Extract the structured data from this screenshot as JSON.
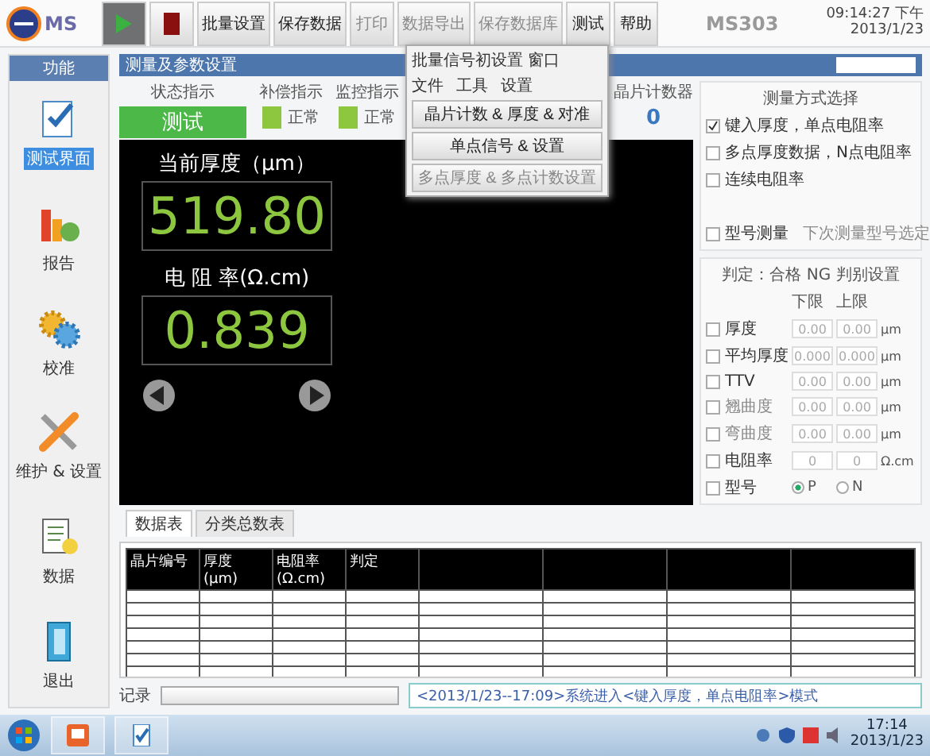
{
  "app": {
    "logo": "MS",
    "title": "MS303",
    "time": "09:14:27 下午",
    "date": "2013/1/23"
  },
  "toolbar": [
    {
      "kind": "play",
      "selected": true,
      "disabled": false
    },
    {
      "kind": "stop",
      "selected": false,
      "disabled": false
    },
    {
      "kind": "text",
      "label": "批量设置",
      "selected": false,
      "disabled": false
    },
    {
      "kind": "text",
      "label": "保存数据",
      "selected": false,
      "disabled": false
    },
    {
      "kind": "text",
      "label": "打印",
      "selected": false,
      "disabled": true
    },
    {
      "kind": "text",
      "label": "数据导出",
      "selected": false,
      "disabled": true
    },
    {
      "kind": "text",
      "label": "保存数据库",
      "selected": false,
      "disabled": true
    },
    {
      "kind": "text",
      "label": "测试",
      "selected": false,
      "disabled": false
    },
    {
      "kind": "text",
      "label": "帮助",
      "selected": false,
      "disabled": false
    }
  ],
  "sidebar": {
    "title": "功能",
    "items": [
      {
        "kind": "test",
        "label": "测试界面",
        "selected": true
      },
      {
        "kind": "report",
        "label": "报告",
        "selected": false
      },
      {
        "kind": "calibrate",
        "label": "校准",
        "selected": false
      },
      {
        "kind": "maintain",
        "label": "维护 & 设置",
        "selected": false
      },
      {
        "kind": "data",
        "label": "数据",
        "selected": false
      },
      {
        "kind": "exit",
        "label": "退出",
        "selected": false
      }
    ]
  },
  "panel_title": "测量及参数设置",
  "indicators": {
    "status": {
      "label": "状态指示",
      "value": "测试",
      "color": "#4cb848"
    },
    "lamps": [
      {
        "label": "补偿指示",
        "state": "正常",
        "color": "#8dc63f"
      },
      {
        "label": "监控指示",
        "state": "正常",
        "color": "#8dc63f"
      }
    ],
    "counter": {
      "label": "晶片计数器",
      "value": "0"
    }
  },
  "readouts": [
    {
      "label": "当前厚度（μm）",
      "value": "519.80"
    },
    {
      "label": "电 阻 率(Ω.cm)",
      "value": "0.839"
    }
  ],
  "mode": {
    "title": "测量方式选择",
    "options": [
      {
        "label": "键入厚度，单点电阻率",
        "checked": true
      },
      {
        "label": "多点厚度数据，N点电阻率",
        "checked": false
      },
      {
        "label": "连续电阻率",
        "checked": false
      }
    ],
    "type_test": {
      "label": "型号测量",
      "checked": false,
      "note": "下次测量型号选定"
    }
  },
  "judge": {
    "title": "判定：合格 NG 判别设置",
    "lower": "下限",
    "upper": "上限",
    "rows": [
      {
        "label": "厚度",
        "checked": false,
        "disabled": false,
        "low": "0.00",
        "high": "0.00",
        "unit": "μm"
      },
      {
        "label": "平均厚度",
        "checked": false,
        "disabled": false,
        "low": "0.000",
        "high": "0.000",
        "unit": "μm"
      },
      {
        "label": "TTV",
        "checked": false,
        "disabled": false,
        "low": "0.00",
        "high": "0.00",
        "unit": "μm"
      },
      {
        "label": "翘曲度",
        "checked": false,
        "disabled": true,
        "low": "0.00",
        "high": "0.00",
        "unit": "μm"
      },
      {
        "label": "弯曲度",
        "checked": false,
        "disabled": true,
        "low": "0.00",
        "high": "0.00",
        "unit": "μm"
      },
      {
        "label": "电阻率",
        "checked": false,
        "disabled": false,
        "low": "0",
        "high": "0",
        "unit": "Ω.cm"
      }
    ],
    "type": {
      "label": "型号",
      "checked": false,
      "options": [
        {
          "label": "P",
          "selected": true
        },
        {
          "label": "N",
          "selected": false
        }
      ]
    }
  },
  "tabs": [
    {
      "label": "数据表",
      "selected": true
    },
    {
      "label": "分类总数表",
      "selected": false
    }
  ],
  "table": {
    "columns": [
      "晶片编号",
      "厚度 (μm)",
      "电阻率 (Ω.cm)",
      "判定"
    ]
  },
  "log": {
    "label": "记录",
    "progress": {
      "level": 0
    },
    "entry": "<2013/1/23--17:09>系统进入<键入厚度，单点电阻率>模式"
  },
  "dialog": {
    "title": "批量信号初设置 窗口",
    "menu": [
      "文件",
      "工具",
      "设置"
    ],
    "buttons": [
      {
        "label": "晶片计数 & 厚度 & 对准",
        "disabled": false
      },
      {
        "label": "单点信号 & 设置",
        "disabled": false
      },
      {
        "label": "多点厚度 & 多点计数设置",
        "disabled": true
      }
    ]
  },
  "taskbar": {
    "time": "17:14",
    "date": "2013/1/23"
  }
}
